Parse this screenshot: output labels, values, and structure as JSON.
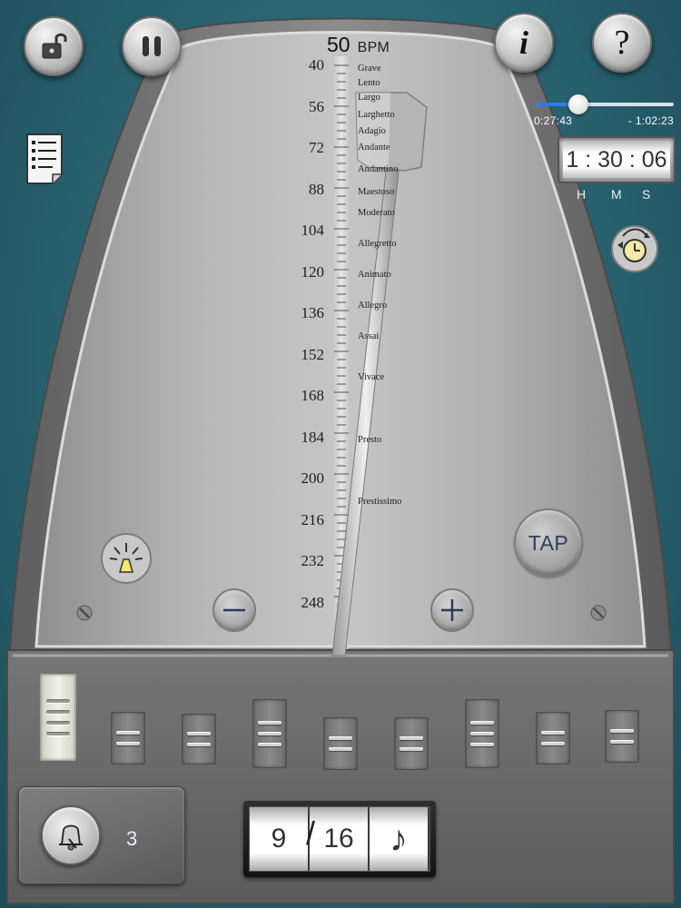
{
  "colors": {
    "background": "#2c6674",
    "accent_blue": "#2c7cf0",
    "tap_text": "#2e3f5e"
  },
  "toolbar": {
    "lock_icon": "unlock-icon",
    "pause_icon": "pause-icon",
    "info_label": "i",
    "help_label": "?"
  },
  "timer": {
    "elapsed": "0:27:43",
    "remaining": "- 1:02:23",
    "progress": 0.31,
    "hours": "1",
    "minutes": "30",
    "seconds": "06",
    "unit_h": "H",
    "unit_m": "M",
    "unit_s": "S"
  },
  "metronome": {
    "bpm": "50",
    "bpm_unit": "BPM",
    "scale_numbers": [
      "40",
      "56",
      "72",
      "88",
      "104",
      "120",
      "136",
      "152",
      "168",
      "184",
      "200",
      "216",
      "232",
      "248"
    ],
    "tempo_names": [
      "Grave",
      "Lento",
      "Largo",
      "Larghetto",
      "Adagio",
      "Andante",
      "Andantino",
      "Maestoso",
      "Moderato",
      "Allegretto",
      "Animato",
      "Allegro",
      "Assai",
      "Vivace",
      "Presto",
      "Prestissimo"
    ],
    "tap_label": "TAP",
    "minus_label": "−",
    "plus_label": "+"
  },
  "beats": [
    {
      "level": 4,
      "accent": true
    },
    {
      "level": 2,
      "accent": false
    },
    {
      "level": 2,
      "accent": false
    },
    {
      "level": 3,
      "accent": false
    },
    {
      "level": 2,
      "accent": false
    },
    {
      "level": 2,
      "accent": false
    },
    {
      "level": 3,
      "accent": false
    },
    {
      "level": 2,
      "accent": false
    },
    {
      "level": 2,
      "accent": false
    }
  ],
  "sound": {
    "icon": "bell-icon",
    "count": "3"
  },
  "time_signature": {
    "numerator": "9",
    "denominator": "16",
    "slash": "/",
    "note_glyph": "♪"
  }
}
